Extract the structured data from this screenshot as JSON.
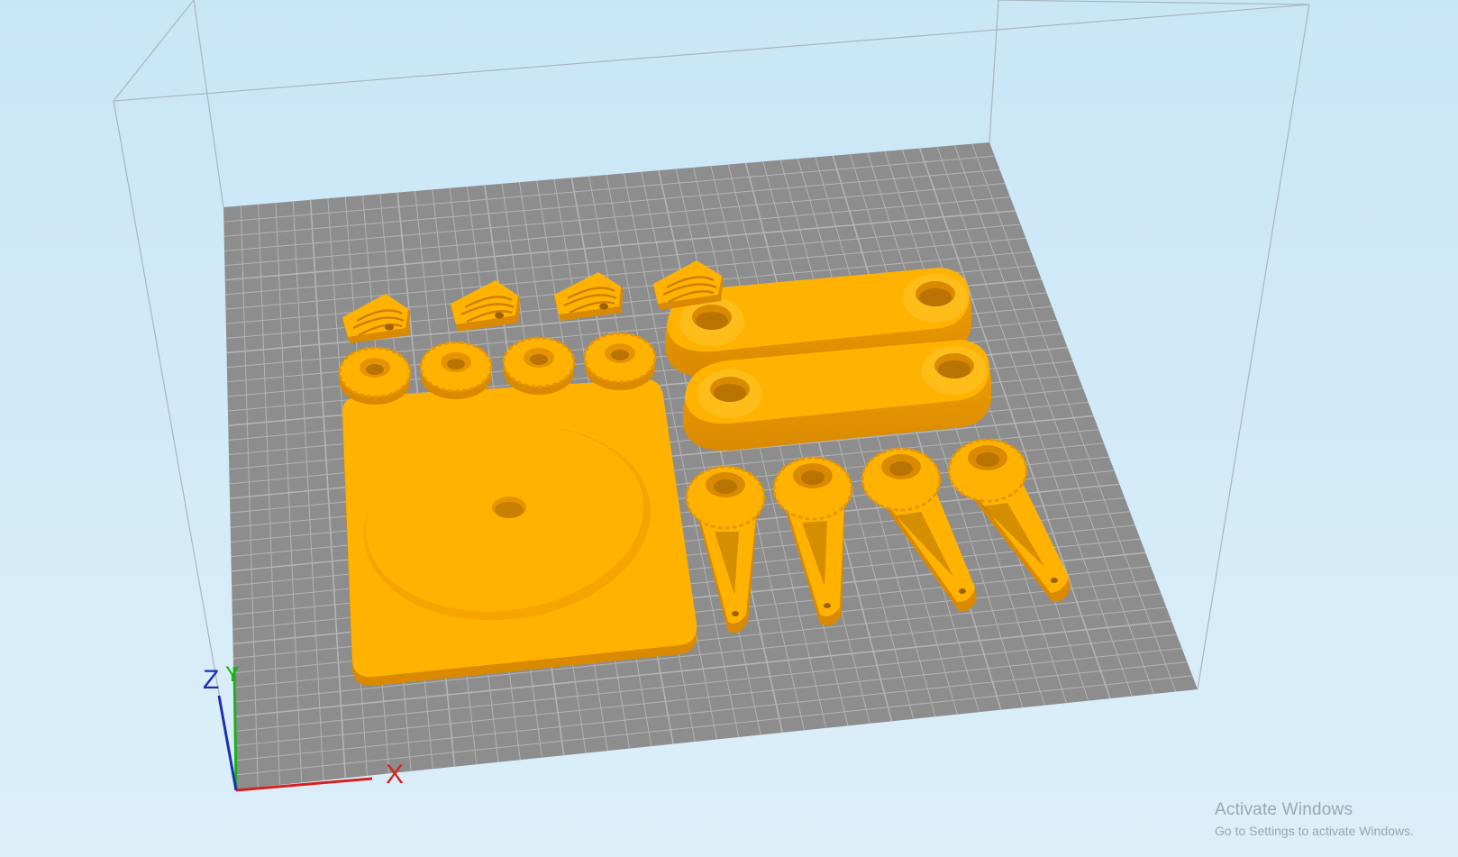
{
  "viewport": {
    "view": "3D build plate",
    "plate_color": "#8d8d8d",
    "grid_color": "#b4b4b4",
    "model_color": "#ffb000",
    "model_dark": "#d98c00",
    "background_color": "#c9e6f7"
  },
  "axes": {
    "x_label": "X",
    "y_label": "Y",
    "z_label": "Z",
    "x_color": "#d62020",
    "y_color": "#19b219",
    "z_color": "#1b2fb4"
  },
  "watermark": {
    "title": "Activate Windows",
    "subtitle": "Go to Settings to activate Windows."
  }
}
